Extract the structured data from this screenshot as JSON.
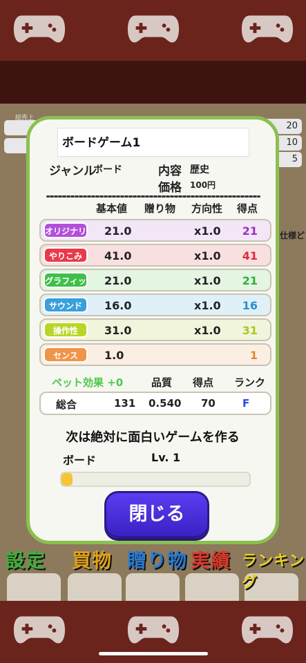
{
  "background": {
    "left_label": "総売上",
    "right_stats": [
      "20",
      "10",
      "5"
    ],
    "side_text": "仕様ど"
  },
  "modal": {
    "title": "ボードゲーム1",
    "genre_label": "ジャンル",
    "genre_value": "ボード",
    "content_label": "内容",
    "content_value": "歴史",
    "price_label": "価格",
    "price_value": "100円",
    "columns": {
      "base": "基本値",
      "gift": "贈り物",
      "direction": "方向性",
      "score": "得点"
    },
    "stats": [
      {
        "name": "オリジナリティ",
        "base": "21.0",
        "mult": "x1.0",
        "score": "21",
        "badge_color": "#b24fd9",
        "row_color": "#f3e6f7",
        "score_color": "#9b30c9"
      },
      {
        "name": "やりこみ",
        "base": "41.0",
        "mult": "x1.0",
        "score": "41",
        "badge_color": "#e83a4a",
        "row_color": "#f8e0e0",
        "score_color": "#e02a3a"
      },
      {
        "name": "グラフィック",
        "base": "21.0",
        "mult": "x1.0",
        "score": "21",
        "badge_color": "#3fbf4a",
        "row_color": "#e4f5e2",
        "score_color": "#2fb03a"
      },
      {
        "name": "サウンド",
        "base": "16.0",
        "mult": "x1.0",
        "score": "16",
        "badge_color": "#3aa0dc",
        "row_color": "#e0f0f8",
        "score_color": "#2a90cc"
      },
      {
        "name": "操作性",
        "base": "31.0",
        "mult": "x1.0",
        "score": "31",
        "badge_color": "#b9d628",
        "row_color": "#f1f5dc",
        "score_color": "#a8c820"
      },
      {
        "name": "センス",
        "base": "1.0",
        "mult": "",
        "score": "1",
        "badge_color": "#f0944a",
        "row_color": "#fbeee2",
        "score_color": "#e58430"
      }
    ],
    "pet_effect": "ペット効果 +0",
    "summary_heads": {
      "quality": "品質",
      "score": "得点",
      "rank": "ランク"
    },
    "total": {
      "label": "総合",
      "value": "131",
      "quality": "0.540",
      "score": "70",
      "rank": "F"
    },
    "next_message": "次は絶対に面白いゲームを作る",
    "genre_level_name": "ボード",
    "genre_level": "Lv. 1",
    "xp_fraction": 0.06,
    "close_label": "閉じる"
  },
  "menu": {
    "items": [
      {
        "label": "設定",
        "color": "#3fae3a"
      },
      {
        "label": "買物",
        "color": "#e0a21a"
      },
      {
        "label": "贈り物",
        "color": "#2a7ad0"
      },
      {
        "label": "実績",
        "color": "#d93a2a"
      },
      {
        "label": "ランキング",
        "color": "#e8d020"
      }
    ]
  },
  "colors": {
    "modal_border": "#8bc04f",
    "close_button": "#4a2ee0"
  }
}
